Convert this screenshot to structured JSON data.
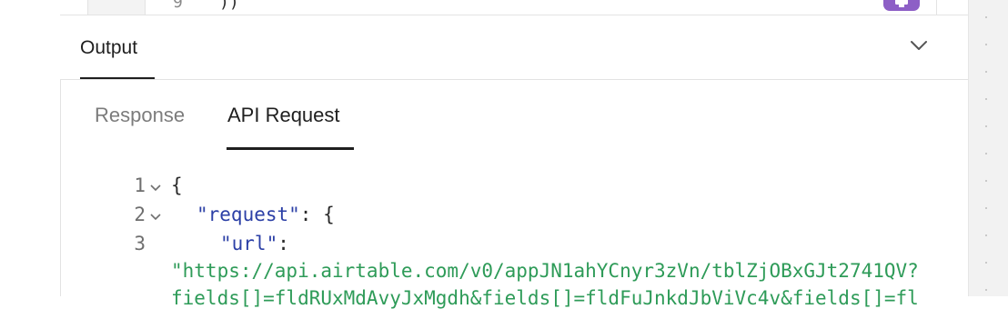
{
  "top_snippet": {
    "line_number": "9",
    "code": "))"
  },
  "output": {
    "title": "Output"
  },
  "tabs": [
    {
      "label": "Response",
      "active": false
    },
    {
      "label": "API Request",
      "active": true
    }
  ],
  "code": {
    "lines": [
      {
        "number": "1",
        "open": "{"
      },
      {
        "number": "2",
        "key": "\"request\"",
        "after": ": {"
      },
      {
        "number": "3",
        "key": "\"url\"",
        "after": ":"
      }
    ],
    "url_line_1": "\"https://api.airtable.com/v0/appJN1ahYCnyr3zVn/tblZjOBxGJt2741QV?",
    "url_line_2": "fields[]=fldRUxMdAvyJxMgdh&fields[]=fldFuJnkdJbViVc4v&fields[]=fl"
  },
  "colors": {
    "key": "#2b3fa6",
    "string": "#2e9b58",
    "accent_badge": "#8d5fc6"
  }
}
